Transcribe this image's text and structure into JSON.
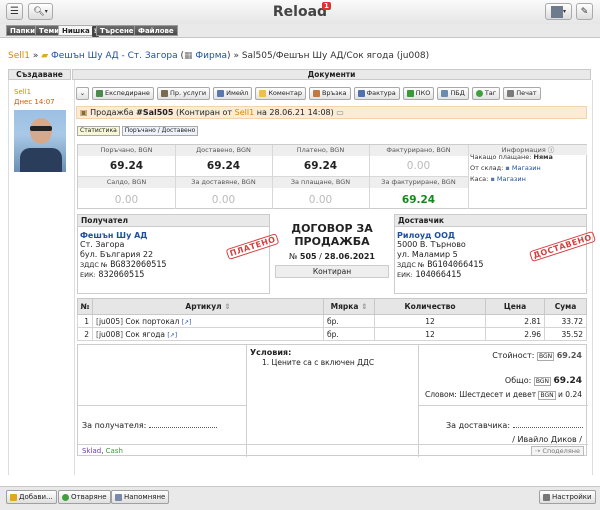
{
  "app": {
    "title": "Reload",
    "badge": "1"
  },
  "tabs": [
    {
      "label": "Папки"
    },
    {
      "label": "Теми"
    },
    {
      "label": "Нишка",
      "help": "?"
    },
    {
      "label": "Търсене"
    },
    {
      "label": "Файлове"
    }
  ],
  "breadcrumb": {
    "root": "Sell1",
    "sep1": "»",
    "folder": "Фешън Шу АД - Ст. Загора",
    "firm_open": "(",
    "firm": "Фирма",
    "firm_close": ")",
    "sep2": "»",
    "current": "Sal505/Фешън Шу АД/Сок ягода (ju008)"
  },
  "left": {
    "header": "Създаване",
    "author": "Sell1",
    "date": "Днес 14:07"
  },
  "documents": {
    "header": "Документи",
    "actions": [
      "Експедиране",
      "Пр. услуги",
      "Имейл",
      "Коментар",
      "Връзка",
      "Фактура",
      "ПКО",
      "ПБД",
      "Таг",
      "Печат"
    ],
    "sale": {
      "prefix": "Продажба",
      "number": "#Sal505",
      "rest": "(Контиран от",
      "by": "Sell1",
      "on": "на 28.06.21 14:08)"
    },
    "subtabs": [
      "Статистика",
      "Поръчано / Доставено"
    ],
    "stats": {
      "row1": [
        {
          "label": "Поръчано, BGN",
          "value": "69.24"
        },
        {
          "label": "Доставено, BGN",
          "value": "69.24"
        },
        {
          "label": "Платено, BGN",
          "value": "69.24"
        },
        {
          "label": "Фактурирано, BGN",
          "value": "0.00"
        }
      ],
      "row2": [
        {
          "label": "Салдо, BGN",
          "value": "0.00"
        },
        {
          "label": "За доставяне, BGN",
          "value": "0.00"
        },
        {
          "label": "За плащане, BGN",
          "value": "0.00"
        },
        {
          "label": "За фактуриране, BGN",
          "value": "69.24"
        }
      ],
      "info_label": "Информация",
      "info": [
        {
          "k": "Чакащо плащане:",
          "v": "Няма"
        },
        {
          "k": "От склад:",
          "v": "Магазин"
        },
        {
          "k": "Каса:",
          "v": "Магазин"
        }
      ]
    },
    "receiver": {
      "header": "Получател",
      "name": "Фешън Шу АД",
      "city": "Ст. Загора",
      "address": "бул. България 22",
      "vat_label": "ЗДДС №",
      "vat": "BG832060515",
      "eik_label": "ЕИК:",
      "eik": "832060515",
      "stamp": "ПЛАТЕНО"
    },
    "contract": {
      "title": "ДОГОВОР ЗА ПРОДАЖБА",
      "no_label": "№",
      "no": "505",
      "sep": "/",
      "date": "28.06.2021",
      "status": "Контиран"
    },
    "supplier": {
      "header": "Доставчик",
      "name": "Рилоуд ООД",
      "city": "5000 В. Търново",
      "address": "ул. Маламир 5",
      "vat_label": "ЗДДС №",
      "vat": "BG104066415",
      "eik_label": "ЕИК:",
      "eik": "104066415",
      "stamp": "ДОСТАВЕНО"
    },
    "items": {
      "headers": [
        "№",
        "Артикул",
        "Мярка",
        "Количество",
        "Цена",
        "Сума"
      ],
      "rows": [
        {
          "n": "1",
          "code": "ju005",
          "name": "Сок портокал",
          "unit": "бр.",
          "qty": "12",
          "price": "2.81",
          "sum": "33.72"
        },
        {
          "n": "2",
          "code": "ju008",
          "name": "Сок ягода",
          "unit": "бр.",
          "qty": "12",
          "price": "2.96",
          "sum": "35.52"
        }
      ]
    },
    "conditions": {
      "title": "Условия:",
      "items": [
        "1. Цените са с включен ДДС"
      ]
    },
    "totals": {
      "value_label": "Стойност:",
      "currency": "BGN",
      "value": "69.24",
      "total_label": "Общо:",
      "total": "69.24",
      "words_label": "Словом:",
      "words_a": "Шестдесет и девет",
      "words_b": "и 0.24"
    },
    "signatures": {
      "receiver_label": "За получателя:",
      "supplier_label": "За доставчика:",
      "supplier_name": "/ Ивайло Диков /"
    },
    "tags": {
      "a": "Sklad",
      "b": "Cash"
    },
    "share": "Споделяне"
  },
  "bottom": {
    "add": "Добави...",
    "open": "Отваряне",
    "remind": "Напомняне",
    "settings": "Настройки"
  }
}
